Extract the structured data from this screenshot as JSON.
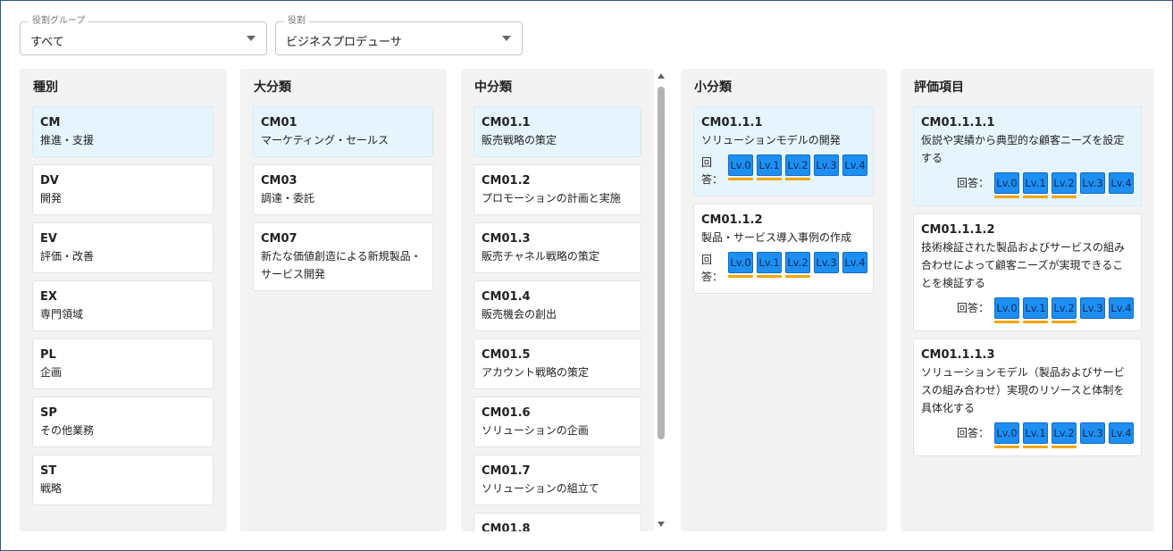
{
  "filters": {
    "group": {
      "label": "役割グループ",
      "value": "すべて"
    },
    "role": {
      "label": "役割",
      "value": "ビジネスプロデューサ"
    }
  },
  "answer_label": "回答：",
  "colors": {
    "accent": "#1e8ff2",
    "selected_bg": "#e6f4fd",
    "underline": "#f0a500"
  },
  "columns": {
    "shubetsu": {
      "title": "種別",
      "items": [
        {
          "code": "CM",
          "name": "推進・支援"
        },
        {
          "code": "DV",
          "name": "開発"
        },
        {
          "code": "EV",
          "name": "評価・改善"
        },
        {
          "code": "EX",
          "name": "専門領域"
        },
        {
          "code": "PL",
          "name": "企画"
        },
        {
          "code": "SP",
          "name": "その他業務"
        },
        {
          "code": "ST",
          "name": "戦略"
        }
      ]
    },
    "daibunrui": {
      "title": "大分類",
      "items": [
        {
          "code": "CM01",
          "name": "マーケティング・セールス"
        },
        {
          "code": "CM03",
          "name": "調達・委託"
        },
        {
          "code": "CM07",
          "name": "新たな価値創造による新規製品・サービス開発"
        }
      ]
    },
    "chubunrui": {
      "title": "中分類",
      "items": [
        {
          "code": "CM01.1",
          "name": "販売戦略の策定"
        },
        {
          "code": "CM01.2",
          "name": "プロモーションの計画と実施"
        },
        {
          "code": "CM01.3",
          "name": "販売チャネル戦略の策定"
        },
        {
          "code": "CM01.4",
          "name": "販売機会の創出"
        },
        {
          "code": "CM01.5",
          "name": "アカウント戦略の策定"
        },
        {
          "code": "CM01.6",
          "name": "ソリューションの企画"
        },
        {
          "code": "CM01.7",
          "name": "ソリューションの組立て"
        },
        {
          "code": "CM01.8",
          "name": ""
        }
      ]
    },
    "shobunrui": {
      "title": "小分類",
      "items": [
        {
          "code": "CM01.1.1",
          "name": "ソリューションモデルの開発",
          "levels": [
            "Lv.0",
            "Lv.1",
            "Lv.2",
            "Lv.3",
            "Lv.4"
          ],
          "answered": [
            true,
            true,
            true,
            false,
            false
          ]
        },
        {
          "code": "CM01.1.2",
          "name": "製品・サービス導入事例の作成",
          "levels": [
            "Lv.0",
            "Lv.1",
            "Lv.2",
            "Lv.3",
            "Lv.4"
          ],
          "answered": [
            true,
            true,
            true,
            false,
            false
          ]
        }
      ]
    },
    "hyoka": {
      "title": "評価項目",
      "items": [
        {
          "code": "CM01.1.1.1",
          "name": "仮説や実績から典型的な顧客ニーズを設定する",
          "levels": [
            "Lv.0",
            "Lv.1",
            "Lv.2",
            "Lv.3",
            "Lv.4"
          ],
          "answered": [
            true,
            true,
            true,
            false,
            false
          ]
        },
        {
          "code": "CM01.1.1.2",
          "name": "技術検証された製品およびサービスの組み合わせによって顧客ニーズが実現できることを検証する",
          "levels": [
            "Lv.0",
            "Lv.1",
            "Lv.2",
            "Lv.3",
            "Lv.4"
          ],
          "answered": [
            true,
            true,
            true,
            false,
            false
          ]
        },
        {
          "code": "CM01.1.1.3",
          "name": "ソリューションモデル（製品およびサービスの組み合わせ）実現のリソースと体制を具体化する",
          "levels": [
            "Lv.0",
            "Lv.1",
            "Lv.2",
            "Lv.3",
            "Lv.4"
          ],
          "answered": [
            true,
            true,
            true,
            false,
            false
          ]
        }
      ]
    }
  }
}
